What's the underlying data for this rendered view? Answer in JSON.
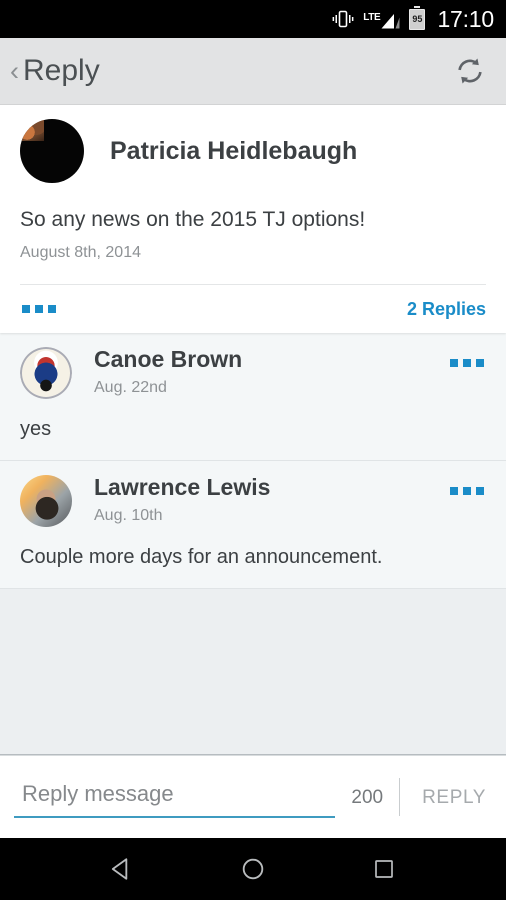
{
  "status_bar": {
    "vibrate_icon": "vibrate-icon",
    "network_label": "LTE",
    "signal_icon": "signal-bars-icon",
    "battery_level": "95",
    "time": "17:10"
  },
  "app_bar": {
    "back_icon": "chevron-left-icon",
    "title": "Reply",
    "refresh_icon": "refresh-icon"
  },
  "post": {
    "avatar": "avatar-patricia-heidlebaugh",
    "author": "Patricia Heidlebaugh",
    "body": "So any news on the 2015 TJ options!",
    "date": "August 8th, 2014",
    "overflow_icon": "more-options-icon",
    "replies_label": "2 Replies"
  },
  "replies": [
    {
      "avatar": "avatar-canoe-brown",
      "author": "Canoe Brown",
      "date": "Aug. 22nd",
      "body": "yes",
      "overflow_icon": "more-options-icon"
    },
    {
      "avatar": "avatar-lawrence-lewis",
      "author": "Lawrence Lewis",
      "date": "Aug. 10th",
      "body": "Couple more days for an announcement.",
      "overflow_icon": "more-options-icon"
    }
  ],
  "compose": {
    "placeholder": "Reply message",
    "value": "",
    "char_count": "200",
    "send_label": "REPLY"
  },
  "nav_bar": {
    "back_icon": "triangle-back-icon",
    "home_icon": "circle-home-icon",
    "recents_icon": "square-recents-icon"
  },
  "colors": {
    "accent_blue": "#1a8cc8",
    "underline_blue": "#3f9bc0",
    "app_bar_bg": "#e2e3e4",
    "text_primary": "#3c4043",
    "text_secondary": "#8e9295",
    "reply_bg": "#f4f7f8",
    "page_bg": "#eceff1"
  }
}
